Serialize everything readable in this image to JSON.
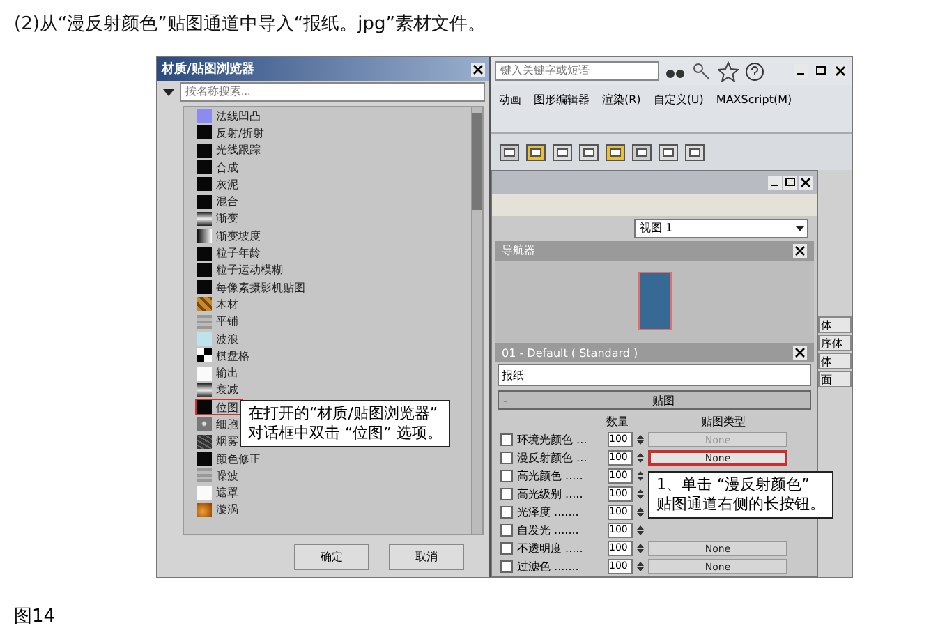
{
  "caption": "(2)从“漫反射颜色”贴图通道中导入“报纸。jpg”素材文件。",
  "browser": {
    "title": "材质/贴图浏览器",
    "search_placeholder": "按名称搜索...",
    "items": [
      {
        "label": "法线凹凸",
        "kind": "bump",
        "selected": false
      },
      {
        "label": "反射/折射",
        "kind": "black",
        "selected": false
      },
      {
        "label": "光线跟踪",
        "kind": "black",
        "selected": false
      },
      {
        "label": "合成",
        "kind": "black",
        "selected": false
      },
      {
        "label": "灰泥",
        "kind": "black",
        "selected": false
      },
      {
        "label": "混合",
        "kind": "black",
        "selected": false
      },
      {
        "label": "渐变",
        "kind": "gradient",
        "selected": false
      },
      {
        "label": "渐变坡度",
        "kind": "ramp",
        "selected": false
      },
      {
        "label": "粒子年龄",
        "kind": "black",
        "selected": false
      },
      {
        "label": "粒子运动模糊",
        "kind": "black",
        "selected": false
      },
      {
        "label": "每像素摄影机贴图",
        "kind": "black",
        "selected": false
      },
      {
        "label": "木材",
        "kind": "wood",
        "selected": false
      },
      {
        "label": "平铺",
        "kind": "tiles",
        "selected": false
      },
      {
        "label": "波浪",
        "kind": "wave",
        "selected": false
      },
      {
        "label": "棋盘格",
        "kind": "checker",
        "selected": false
      },
      {
        "label": "输出",
        "kind": "white",
        "selected": false
      },
      {
        "label": "衰减",
        "kind": "gradient",
        "selected": false
      },
      {
        "label": "位图",
        "kind": "black",
        "selected": true
      },
      {
        "label": "细胞",
        "kind": "cellular",
        "selected": false
      },
      {
        "label": "烟雾",
        "kind": "noise",
        "selected": false
      },
      {
        "label": "颜色修正",
        "kind": "black",
        "selected": false
      },
      {
        "label": "噪波",
        "kind": "tiles",
        "selected": false
      },
      {
        "label": "遮罩",
        "kind": "white",
        "selected": false
      },
      {
        "label": "漩涡",
        "kind": "swirl",
        "selected": false
      }
    ],
    "buttons": [
      "确定",
      "取消"
    ]
  },
  "callouts": [
    {
      "lines": [
        "在打开的“材质/贴图浏览器”",
        "对话框中双击 “位图” 选项。"
      ]
    },
    {
      "lines": [
        "1、单击 “漫反射颜色”",
        "贴图通道右侧的长按钮。"
      ]
    }
  ],
  "app": {
    "search_placeholder": "键入关键字或短语",
    "menu": [
      "动画",
      "图形编辑器",
      "渲染(R)",
      "自定义(U)",
      "MAXScript(M)"
    ]
  },
  "editor": {
    "viewport": "视图 1",
    "navigator": "导航器",
    "material": "01 - Default ( Standard )",
    "name": "报纸",
    "rollout_toggle": "-",
    "rollout": "贴图",
    "columns": [
      "数量",
      "贴图类型"
    ],
    "maps": [
      {
        "label": "环境光颜色 ...",
        "amount": "100",
        "map": "None",
        "checked": false,
        "disabled": true,
        "highlighted": false
      },
      {
        "label": "漫反射颜色 ...",
        "amount": "100",
        "map": "None",
        "checked": false,
        "disabled": false,
        "highlighted": true
      },
      {
        "label": "高光颜色 .....",
        "amount": "100",
        "checked": false
      },
      {
        "label": "高光级别 .....",
        "amount": "100",
        "checked": false
      },
      {
        "label": "光泽度 .......",
        "amount": "100",
        "checked": false
      },
      {
        "label": "自发光 .......",
        "amount": "100",
        "checked": false
      },
      {
        "label": "不透明度 .....",
        "amount": "100",
        "map": "None",
        "checked": false,
        "disabled": false,
        "highlighted": false
      },
      {
        "label": "过滤色 .......",
        "amount": "100",
        "map": "None",
        "checked": false,
        "disabled": false,
        "highlighted": false
      }
    ]
  },
  "command_panel": {
    "buttons": [
      "体",
      "序体",
      "体",
      "面"
    ]
  },
  "figure_label": "图14"
}
